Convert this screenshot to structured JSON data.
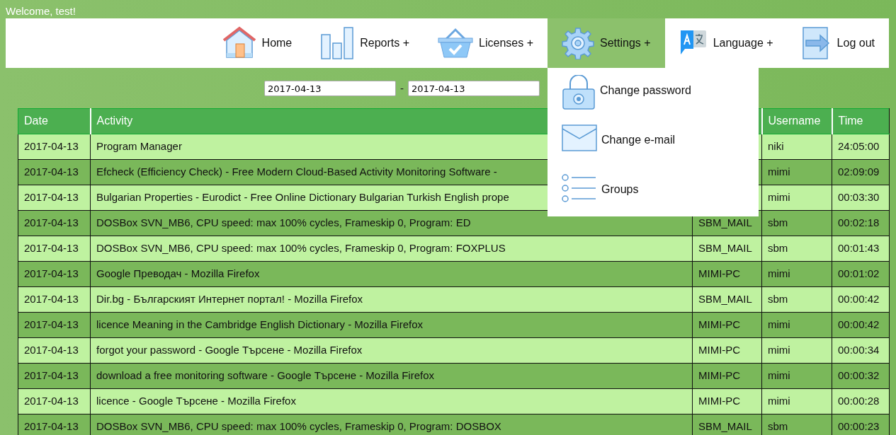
{
  "welcome": "Welcome, test!",
  "nav": [
    {
      "label": "Home",
      "selected": false
    },
    {
      "label": "Reports +",
      "selected": false
    },
    {
      "label": "Licenses +",
      "selected": false
    },
    {
      "label": "Settings +",
      "selected": true
    },
    {
      "label": "Language +",
      "selected": false
    },
    {
      "label": "Log out",
      "selected": false
    }
  ],
  "dropdown": [
    {
      "label": "Change password"
    },
    {
      "label": "Change e-mail"
    },
    {
      "label": "Groups"
    }
  ],
  "date_from": "2017-04-13",
  "date_separator": "-",
  "date_to": "2017-04-13",
  "table": {
    "columns": {
      "date": "Date",
      "activity": "Activity",
      "username": "Username",
      "time": "Time"
    },
    "rows": [
      {
        "date": "2017-04-13",
        "activity": "Program Manager",
        "username": "niki",
        "time": "24:05:00"
      },
      {
        "date": "2017-04-13",
        "activity": "Efcheck (Efficiency Check) - Free Modern Cloud-Based Activity Monitoring Software -",
        "username": "mimi",
        "time": "02:09:09"
      },
      {
        "date": "2017-04-13",
        "activity": "Bulgarian Properties - Eurodict - Free Online Dictionary Bulgarian Turkish English prope",
        "username": "mimi",
        "time": "00:03:30"
      },
      {
        "date": "2017-04-13",
        "activity": "DOSBox SVN_MB6, CPU speed: max 100% cycles, Frameskip 0, Program: ED",
        "computer": "SBM_MAIL",
        "username": "sbm",
        "time": "00:02:18"
      },
      {
        "date": "2017-04-13",
        "activity": "DOSBox SVN_MB6, CPU speed: max 100% cycles, Frameskip 0, Program: FOXPLUS",
        "computer": "SBM_MAIL",
        "username": "sbm",
        "time": "00:01:43"
      },
      {
        "date": "2017-04-13",
        "activity": "Google Преводач - Mozilla Firefox",
        "computer": "MIMI-PC",
        "username": "mimi",
        "time": "00:01:02"
      },
      {
        "date": "2017-04-13",
        "activity": "Dir.bg - Българският Интернет портал! - Mozilla Firefox",
        "computer": "SBM_MAIL",
        "username": "sbm",
        "time": "00:00:42"
      },
      {
        "date": "2017-04-13",
        "activity": "licence Meaning in the Cambridge English Dictionary - Mozilla Firefox",
        "computer": "MIMI-PC",
        "username": "mimi",
        "time": "00:00:42"
      },
      {
        "date": "2017-04-13",
        "activity": "forgot your password - Google Търсене - Mozilla Firefox",
        "computer": "MIMI-PC",
        "username": "mimi",
        "time": "00:00:34"
      },
      {
        "date": "2017-04-13",
        "activity": "download a free monitoring software - Google Търсене - Mozilla Firefox",
        "computer": "MIMI-PC",
        "username": "mimi",
        "time": "00:00:32"
      },
      {
        "date": "2017-04-13",
        "activity": "licence - Google Търсене - Mozilla Firefox",
        "computer": "MIMI-PC",
        "username": "mimi",
        "time": "00:00:28"
      },
      {
        "date": "2017-04-13",
        "activity": "DOSBox SVN_MB6, CPU speed: max 100% cycles, Frameskip 0, Program: DOSBOX",
        "computer": "SBM_MAIL",
        "username": "sbm",
        "time": "00:00:23"
      }
    ]
  }
}
